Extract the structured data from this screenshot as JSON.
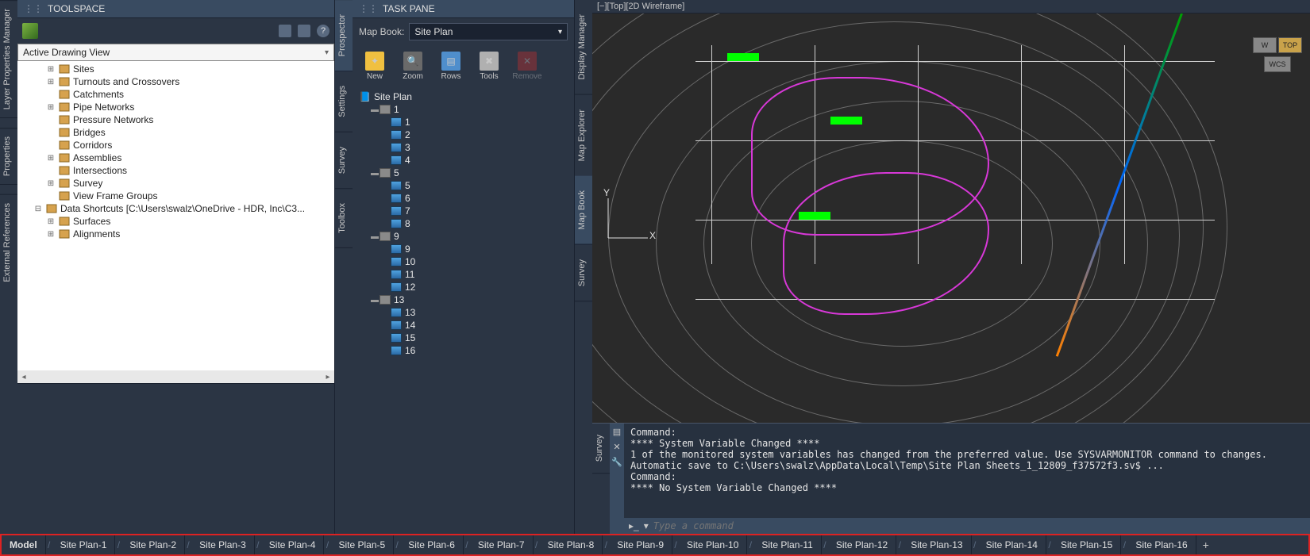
{
  "left_rail": {
    "tabs": [
      "Layer Properties Manager",
      "Properties",
      "External References"
    ]
  },
  "toolspace": {
    "title": "TOOLSPACE",
    "toolbar_icons": [
      "tree-icon",
      "list-icon",
      "help-icon"
    ],
    "view_dropdown": "Active Drawing View",
    "tree": [
      {
        "indent": 2,
        "exp": "+",
        "icon": "sites",
        "label": "Sites"
      },
      {
        "indent": 2,
        "exp": "+",
        "icon": "turnout",
        "label": "Turnouts and Crossovers"
      },
      {
        "indent": 2,
        "exp": "",
        "icon": "catch",
        "label": "Catchments"
      },
      {
        "indent": 2,
        "exp": "+",
        "icon": "pipe",
        "label": "Pipe Networks"
      },
      {
        "indent": 2,
        "exp": "",
        "icon": "pipe",
        "label": "Pressure Networks"
      },
      {
        "indent": 2,
        "exp": "",
        "icon": "bridge",
        "label": "Bridges"
      },
      {
        "indent": 2,
        "exp": "",
        "icon": "corridor",
        "label": "Corridors"
      },
      {
        "indent": 2,
        "exp": "+",
        "icon": "assembly",
        "label": "Assemblies"
      },
      {
        "indent": 2,
        "exp": "",
        "icon": "intersect",
        "label": "Intersections"
      },
      {
        "indent": 2,
        "exp": "+",
        "icon": "survey",
        "label": "Survey"
      },
      {
        "indent": 2,
        "exp": "",
        "icon": "viewframe",
        "label": "View Frame Groups"
      },
      {
        "indent": 1,
        "exp": "-",
        "icon": "shortcut",
        "label": "Data Shortcuts [C:\\Users\\swalz\\OneDrive - HDR, Inc\\C3..."
      },
      {
        "indent": 2,
        "exp": "+",
        "icon": "surface",
        "label": "Surfaces"
      },
      {
        "indent": 2,
        "exp": "+",
        "icon": "align",
        "label": "Alignments"
      }
    ],
    "side_tabs": [
      "Prospector",
      "Settings",
      "Survey",
      "Toolbox"
    ]
  },
  "taskpane": {
    "title": "TASK PANE",
    "mapbook_label": "Map Book:",
    "mapbook_value": "Site Plan",
    "buttons": [
      {
        "label": "New",
        "icon": "new",
        "enabled": true
      },
      {
        "label": "Zoom",
        "icon": "zoom",
        "enabled": true
      },
      {
        "label": "Rows",
        "icon": "rows",
        "enabled": true
      },
      {
        "label": "Tools",
        "icon": "tools",
        "enabled": true
      },
      {
        "label": "Remove",
        "icon": "remove",
        "enabled": false
      }
    ],
    "root": "Site Plan",
    "groups": [
      {
        "head": "1",
        "items": [
          "1",
          "2",
          "3",
          "4"
        ]
      },
      {
        "head": "5",
        "items": [
          "5",
          "6",
          "7",
          "8"
        ]
      },
      {
        "head": "9",
        "items": [
          "9",
          "10",
          "11",
          "12"
        ]
      },
      {
        "head": "13",
        "items": [
          "13",
          "14",
          "15",
          "16"
        ]
      }
    ],
    "side_tabs": [
      "Display Manager",
      "Map Explorer",
      "Map Book",
      "Survey"
    ]
  },
  "viewport": {
    "header": "[−][Top][2D Wireframe]",
    "viewcube": {
      "top": "TOP",
      "w": "W",
      "wcs": "WCS"
    },
    "ucs": {
      "x": "X",
      "y": "Y"
    }
  },
  "command": {
    "lines": [
      "Command:",
      "**** System Variable Changed ****",
      "1 of the monitored system variables has changed from the preferred value. Use SYSVARMONITOR command to changes.",
      "Automatic save to C:\\Users\\swalz\\AppData\\Local\\Temp\\Site Plan Sheets_1_12809_f37572f3.sv$ ...",
      "Command:",
      "**** No System Variable Changed ****"
    ],
    "prompt_placeholder": "Type a command",
    "side_tab": "Survey"
  },
  "layout_tabs": {
    "model": "Model",
    "sheets": [
      "Site Plan-1",
      "Site Plan-2",
      "Site Plan-3",
      "Site Plan-4",
      "Site Plan-5",
      "Site Plan-6",
      "Site Plan-7",
      "Site Plan-8",
      "Site Plan-9",
      "Site Plan-10",
      "Site Plan-11",
      "Site Plan-12",
      "Site Plan-13",
      "Site Plan-14",
      "Site Plan-15",
      "Site Plan-16"
    ]
  },
  "colors": {
    "accent": "#394b61",
    "highlight_box": "#d22222",
    "magenta": "#d838d8",
    "green": "#00ff00",
    "blue_line": "#0066ff"
  }
}
